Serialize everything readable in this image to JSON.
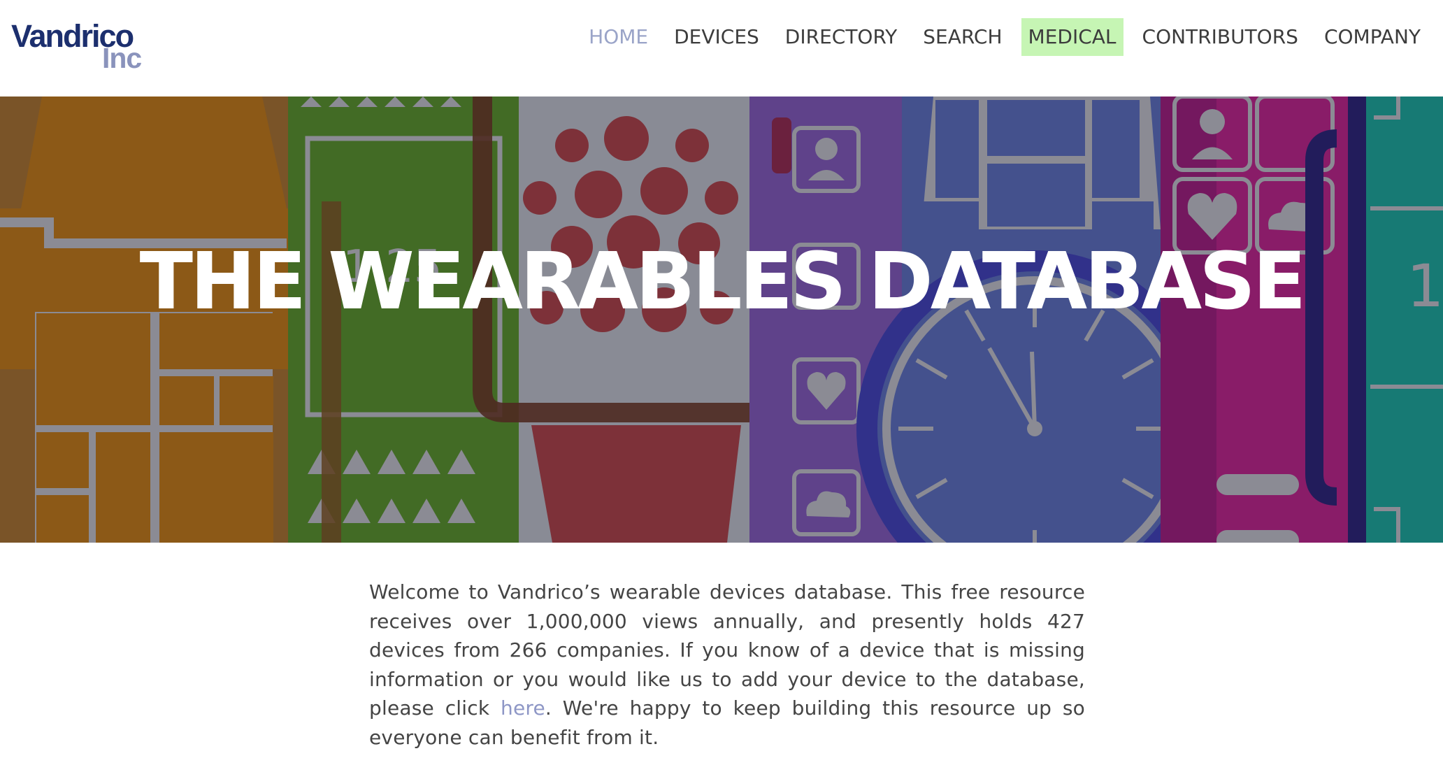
{
  "logo": {
    "main": "Vandrico",
    "sub": "Inc"
  },
  "nav": {
    "items": [
      {
        "label": "HOME"
      },
      {
        "label": "DEVICES"
      },
      {
        "label": "DIRECTORY"
      },
      {
        "label": "SEARCH"
      },
      {
        "label": "MEDICAL"
      },
      {
        "label": "CONTRIBUTORS"
      },
      {
        "label": "COMPANY"
      }
    ]
  },
  "hero": {
    "title": "THE WEARABLES DATABASE",
    "watch_face_text": "1 25",
    "band_digit": "1"
  },
  "intro": {
    "text_before_link": "Welcome to Vandrico’s wearable devices database. This free resource receives over 1,000,000 views annually, and presently holds 427 devices from 266 companies. If you know of a device that is missing information or you would like us to add your device to the database, please click ",
    "link_text": "here",
    "text_after_link": ". We're happy to keep building this resource up so everyone can benefit from it."
  },
  "colors": {
    "nav_active": "#9aa4c8",
    "nav_highlight": "#c6f5b4",
    "link": "#8e97c6",
    "logo_primary": "#1c2f6e",
    "logo_secondary": "#8a93bc"
  }
}
